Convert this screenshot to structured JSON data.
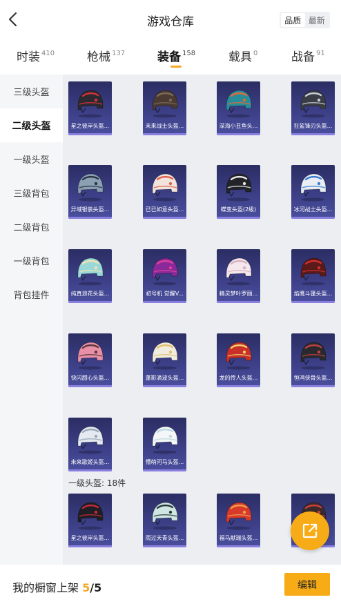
{
  "header": {
    "title": "游戏仓库",
    "sort_options": [
      "品质",
      "最新"
    ],
    "active_sort": "品质"
  },
  "tabs": [
    {
      "label": "时装",
      "count": "410"
    },
    {
      "label": "枪械",
      "count": "137"
    },
    {
      "label": "装备",
      "count": "158",
      "active": true
    },
    {
      "label": "载具",
      "count": "0"
    },
    {
      "label": "战备",
      "count": "91"
    }
  ],
  "sidebar": {
    "items": [
      "三级头盔",
      "二级头盔",
      "一级头盔",
      "三级背包",
      "二级背包",
      "一级背包",
      "背包挂件"
    ],
    "active": "二级头盔"
  },
  "content": {
    "items": [
      {
        "name": "星之彼岸头盔...",
        "color": "#2a2a30",
        "accent": "#d8323a"
      },
      {
        "name": "未来战士头盔...",
        "color": "#4a3a32",
        "accent": "#7a6a5a"
      },
      {
        "name": "深海小丑鱼头...",
        "color": "#2a8d9a",
        "accent": "#e06a3a"
      },
      {
        "name": "狂鲨锋刃头盔...",
        "color": "#3a3d44",
        "accent": "#c7ccd6"
      },
      {
        "name": "异域银装头盔...",
        "color": "#8ca0b4",
        "accent": "#2a3444"
      },
      {
        "name": "已已如意头盔...",
        "color": "#f0e4dc",
        "accent": "#e06050"
      },
      {
        "name": "蝶变头盔(2级)",
        "color": "#222428",
        "accent": "#e8e8e8"
      },
      {
        "name": "冰河战士头盔...",
        "color": "#e8eef4",
        "accent": "#3a7ad0"
      },
      {
        "name": "纯真浪花头盔...",
        "color": "#9ad8d8",
        "accent": "#f4e0b0"
      },
      {
        "name": "初号机 觉醒V...",
        "color": "#8a2a9a",
        "accent": "#e0409a"
      },
      {
        "name": "精灵梦叶罗丽...",
        "color": "#f4e8ec",
        "accent": "#d8b0c0"
      },
      {
        "name": "焰鹰斗篷头盔...",
        "color": "#5a1a1a",
        "accent": "#d03030"
      },
      {
        "name": "快闪甜心头盔...",
        "color": "#e890a8",
        "accent": "#5a3a3a"
      },
      {
        "name": "蓬影滴波头盔...",
        "color": "#f0ece0",
        "accent": "#e0c070"
      },
      {
        "name": "龙的传人头盔...",
        "color": "#c83028",
        "accent": "#f0d070"
      },
      {
        "name": "恒鸿侠骨头盔...",
        "color": "#2a2a2e",
        "accent": "#c04040"
      },
      {
        "name": "未来歌姬头盔...",
        "color": "#e4eaf0",
        "accent": "#9aa8b8"
      },
      {
        "name": "懵萌河马头盔...",
        "color": "#f4f6f8",
        "accent": "#bcd8e0"
      }
    ],
    "section_label": "一级头盔: 18件",
    "section_items": [
      {
        "name": "星之彼岸头盔...",
        "color": "#1e1e24",
        "accent": "#c82a3a"
      },
      {
        "name": "雨过天青头盔...",
        "color": "#cfe6e2",
        "accent": "#2a3a3a"
      },
      {
        "name": "福马献瑞头盔...",
        "color": "#d83a2a",
        "accent": "#f0a050"
      },
      {
        "name": "",
        "color": "#3a2a2a",
        "accent": "#d04040"
      }
    ]
  },
  "bottom": {
    "label": "我的橱窗上架",
    "current": "5",
    "separator": "/",
    "total": "5",
    "edit_label": "编辑"
  },
  "fab": {
    "icon": "share-icon"
  }
}
